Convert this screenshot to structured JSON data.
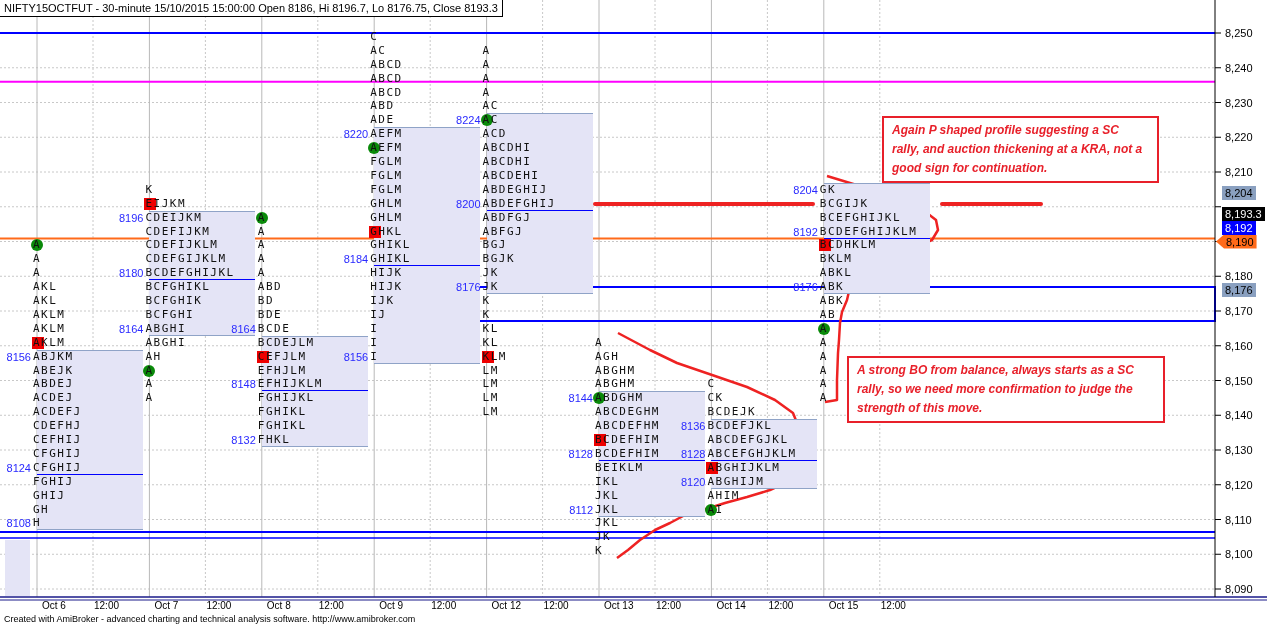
{
  "title": "NIFTY15OCTFUT - 30-minute 15/10/2015 15:00:00 Open 8186, Hi 8196.7, Lo 8176.75, Close 8193.3",
  "days": [
    {
      "date": "Oct 6",
      "time": "12:00",
      "rows": [
        {
          "letters": "A",
          "va": false,
          "poc": false,
          "open": true,
          "close": false
        },
        {
          "letters": "A",
          "va": false,
          "poc": false,
          "open": false,
          "close": false
        },
        {
          "letters": "A",
          "va": false,
          "poc": false,
          "open": false,
          "close": false
        },
        {
          "letters": "AKL",
          "va": false,
          "poc": false,
          "open": false,
          "close": false
        },
        {
          "letters": "AKL",
          "va": false,
          "poc": false,
          "open": false,
          "close": false
        },
        {
          "letters": "AKLM",
          "va": false,
          "poc": false,
          "open": false,
          "close": false
        },
        {
          "letters": "AKLM",
          "va": false,
          "poc": false,
          "open": false,
          "close": false
        },
        {
          "letters": "AKLM",
          "va": false,
          "poc": false,
          "open": false,
          "close": true
        },
        {
          "letters": "ABJKM",
          "label": "8156",
          "va": true,
          "poc": false,
          "open": false,
          "close": false
        },
        {
          "letters": "ABEJK",
          "va": true,
          "poc": false,
          "open": false,
          "close": false
        },
        {
          "letters": "ABDEJ",
          "va": true,
          "poc": false,
          "open": false,
          "close": false
        },
        {
          "letters": "ACDEJ",
          "va": true,
          "poc": false,
          "open": false,
          "close": false
        },
        {
          "letters": "ACDEFJ",
          "va": true,
          "poc": false,
          "open": false,
          "close": false
        },
        {
          "letters": "CDEFHJ",
          "va": true,
          "poc": false,
          "open": false,
          "close": false
        },
        {
          "letters": "CEFHIJ",
          "va": true,
          "poc": false,
          "open": false,
          "close": false
        },
        {
          "letters": "CFGHIJ",
          "va": true,
          "poc": false,
          "open": false,
          "close": false
        },
        {
          "letters": "CFGHIJ",
          "label": "8124",
          "va": true,
          "poc": true,
          "open": false,
          "close": false
        },
        {
          "letters": "FGHIJ",
          "va": true,
          "poc": false,
          "open": false,
          "close": false
        },
        {
          "letters": "GHIJ",
          "va": true,
          "poc": false,
          "open": false,
          "close": false
        },
        {
          "letters": "GH",
          "va": true,
          "poc": false,
          "open": false,
          "close": false
        },
        {
          "letters": "H",
          "label": "8108",
          "va": true,
          "poc": false,
          "open": false,
          "close": false
        }
      ]
    },
    {
      "date": "Oct 7",
      "time": "12:00",
      "rows": [
        {
          "letters": "K",
          "va": false,
          "poc": false,
          "open": false,
          "close": false
        },
        {
          "letters": "EIJKM",
          "va": false,
          "poc": false,
          "open": false,
          "close": true
        },
        {
          "letters": "CDEIJKM",
          "label": "8196",
          "va": true,
          "poc": false,
          "open": false,
          "close": false
        },
        {
          "letters": "CDEFIJKM",
          "va": true,
          "poc": false,
          "open": false,
          "close": false
        },
        {
          "letters": "CDEFIJKLM",
          "va": true,
          "poc": false,
          "open": false,
          "close": false
        },
        {
          "letters": "CDEFGIJKLM",
          "va": true,
          "poc": false,
          "open": false,
          "close": false
        },
        {
          "letters": "BCDEFGHIJKL",
          "label": "8180",
          "va": true,
          "poc": true,
          "open": false,
          "close": false
        },
        {
          "letters": "BCFGHIKL",
          "va": true,
          "poc": false,
          "open": false,
          "close": false
        },
        {
          "letters": "BCFGHIK",
          "va": true,
          "poc": false,
          "open": false,
          "close": false
        },
        {
          "letters": "BCFGHI",
          "va": true,
          "poc": false,
          "open": false,
          "close": false
        },
        {
          "letters": "ABGHI",
          "label": "8164",
          "va": true,
          "poc": false,
          "open": false,
          "close": false
        },
        {
          "letters": "ABGHI",
          "va": false,
          "poc": false,
          "open": false,
          "close": false
        },
        {
          "letters": "AH",
          "va": false,
          "poc": false,
          "open": false,
          "close": false
        },
        {
          "letters": "A",
          "va": false,
          "poc": false,
          "open": true,
          "close": false
        },
        {
          "letters": "A",
          "va": false,
          "poc": false,
          "open": false,
          "close": false
        },
        {
          "letters": "A",
          "va": false,
          "poc": false,
          "open": false,
          "close": false
        }
      ]
    },
    {
      "date": "Oct 8",
      "time": "12:00",
      "rows": [
        {
          "letters": "A",
          "va": false,
          "poc": false,
          "open": true,
          "close": false
        },
        {
          "letters": "A",
          "va": false,
          "poc": false,
          "open": false,
          "close": false
        },
        {
          "letters": "A",
          "va": false,
          "poc": false,
          "open": false,
          "close": false
        },
        {
          "letters": "A",
          "va": false,
          "poc": false,
          "open": false,
          "close": false
        },
        {
          "letters": "A",
          "va": false,
          "poc": false,
          "open": false,
          "close": false
        },
        {
          "letters": "ABD",
          "va": false,
          "poc": false,
          "open": false,
          "close": false
        },
        {
          "letters": "BD",
          "va": false,
          "poc": false,
          "open": false,
          "close": false
        },
        {
          "letters": "BDE",
          "va": false,
          "poc": false,
          "open": false,
          "close": false
        },
        {
          "letters": "BCDE",
          "label": "8164",
          "va": false,
          "poc": false,
          "open": false,
          "close": false
        },
        {
          "letters": "BCDEJLM",
          "va": true,
          "poc": false,
          "open": false,
          "close": false
        },
        {
          "letters": "CEFJLM",
          "va": true,
          "poc": false,
          "open": false,
          "close": true
        },
        {
          "letters": "EFHJLM",
          "va": true,
          "poc": false,
          "open": false,
          "close": false
        },
        {
          "letters": "EFHIJKLM",
          "label": "8148",
          "va": true,
          "poc": true,
          "open": false,
          "close": false
        },
        {
          "letters": "FGHIJKL",
          "va": true,
          "poc": false,
          "open": false,
          "close": false
        },
        {
          "letters": "FGHIKL",
          "va": true,
          "poc": false,
          "open": false,
          "close": false
        },
        {
          "letters": "FGHIKL",
          "va": true,
          "poc": false,
          "open": false,
          "close": false
        },
        {
          "letters": "FHKL",
          "label": "8132",
          "va": true,
          "poc": false,
          "open": false,
          "close": false
        }
      ]
    },
    {
      "date": "Oct 9",
      "time": "12:00",
      "rows": [
        {
          "letters": "C",
          "va": false,
          "poc": false,
          "open": false,
          "close": false
        },
        {
          "letters": "AC",
          "va": false,
          "poc": false,
          "open": false,
          "close": false
        },
        {
          "letters": "ABCD",
          "va": false,
          "poc": false,
          "open": false,
          "close": false
        },
        {
          "letters": "ABCD",
          "va": false,
          "poc": false,
          "open": false,
          "close": false
        },
        {
          "letters": "ABCD",
          "va": false,
          "poc": false,
          "open": false,
          "close": false
        },
        {
          "letters": "ABD",
          "va": false,
          "poc": false,
          "open": false,
          "close": false
        },
        {
          "letters": "ADE",
          "va": false,
          "poc": false,
          "open": false,
          "close": false
        },
        {
          "letters": "AEFM",
          "label": "8220",
          "va": true,
          "poc": false,
          "open": false,
          "close": false
        },
        {
          "letters": "AEFM",
          "va": true,
          "poc": false,
          "open": true,
          "close": false
        },
        {
          "letters": "FGLM",
          "va": true,
          "poc": false,
          "open": false,
          "close": false
        },
        {
          "letters": "FGLM",
          "va": true,
          "poc": false,
          "open": false,
          "close": false
        },
        {
          "letters": "FGLM",
          "va": true,
          "poc": false,
          "open": false,
          "close": false
        },
        {
          "letters": "GHLM",
          "va": true,
          "poc": false,
          "open": false,
          "close": false
        },
        {
          "letters": "GHLM",
          "va": true,
          "poc": false,
          "open": false,
          "close": false
        },
        {
          "letters": "GHKL",
          "va": true,
          "poc": false,
          "open": false,
          "close": true
        },
        {
          "letters": "GHIKL",
          "va": true,
          "poc": false,
          "open": false,
          "close": false
        },
        {
          "letters": "GHIKL",
          "label": "8184",
          "va": true,
          "poc": true,
          "open": false,
          "close": false
        },
        {
          "letters": "HIJK",
          "va": true,
          "poc": false,
          "open": false,
          "close": false
        },
        {
          "letters": "HIJK",
          "va": true,
          "poc": false,
          "open": false,
          "close": false
        },
        {
          "letters": "IJK",
          "va": true,
          "poc": false,
          "open": false,
          "close": false
        },
        {
          "letters": "IJ",
          "va": true,
          "poc": false,
          "open": false,
          "close": false
        },
        {
          "letters": "I",
          "va": true,
          "poc": false,
          "open": false,
          "close": false
        },
        {
          "letters": "I",
          "va": true,
          "poc": false,
          "open": false,
          "close": false
        },
        {
          "letters": "I",
          "label": "8156",
          "va": true,
          "poc": false,
          "open": false,
          "close": false
        }
      ]
    },
    {
      "date": "Oct 12",
      "time": "12:00",
      "rows": [
        {
          "letters": "A",
          "va": false,
          "poc": false,
          "open": false,
          "close": false
        },
        {
          "letters": "A",
          "va": false,
          "poc": false,
          "open": false,
          "close": false
        },
        {
          "letters": "A",
          "va": false,
          "poc": false,
          "open": false,
          "close": false
        },
        {
          "letters": "A",
          "va": false,
          "poc": false,
          "open": false,
          "close": false
        },
        {
          "letters": "AC",
          "va": false,
          "poc": false,
          "open": false,
          "close": false
        },
        {
          "letters": "AC",
          "label": "8224",
          "va": true,
          "poc": false,
          "open": true,
          "close": false
        },
        {
          "letters": "ACD",
          "va": true,
          "poc": false,
          "open": false,
          "close": false
        },
        {
          "letters": "ABCDHI",
          "va": true,
          "poc": false,
          "open": false,
          "close": false
        },
        {
          "letters": "ABCDHI",
          "va": true,
          "poc": false,
          "open": false,
          "close": false
        },
        {
          "letters": "ABCDEHI",
          "va": true,
          "poc": false,
          "open": false,
          "close": false
        },
        {
          "letters": "ABDEGHIJ",
          "va": true,
          "poc": false,
          "open": false,
          "close": false
        },
        {
          "letters": "ABDEFGHIJ",
          "label": "8200",
          "va": true,
          "poc": true,
          "open": false,
          "close": false
        },
        {
          "letters": "ABDFGJ",
          "va": true,
          "poc": false,
          "open": false,
          "close": false
        },
        {
          "letters": "ABFGJ",
          "va": true,
          "poc": false,
          "open": false,
          "close": false
        },
        {
          "letters": "BGJ",
          "va": true,
          "poc": false,
          "open": false,
          "close": false
        },
        {
          "letters": "BGJK",
          "va": true,
          "poc": false,
          "open": false,
          "close": false
        },
        {
          "letters": "JK",
          "va": true,
          "poc": false,
          "open": false,
          "close": false
        },
        {
          "letters": "JK",
          "label": "8176",
          "va": true,
          "poc": false,
          "open": false,
          "close": false
        },
        {
          "letters": "K",
          "va": false,
          "poc": false,
          "open": false,
          "close": false
        },
        {
          "letters": "K",
          "va": false,
          "poc": false,
          "open": false,
          "close": false
        },
        {
          "letters": "KL",
          "va": false,
          "poc": false,
          "open": false,
          "close": false
        },
        {
          "letters": "KL",
          "va": false,
          "poc": false,
          "open": false,
          "close": false
        },
        {
          "letters": "KLM",
          "va": false,
          "poc": false,
          "open": false,
          "close": true
        },
        {
          "letters": "LM",
          "va": false,
          "poc": false,
          "open": false,
          "close": false
        },
        {
          "letters": "LM",
          "va": false,
          "poc": false,
          "open": false,
          "close": false
        },
        {
          "letters": "LM",
          "va": false,
          "poc": false,
          "open": false,
          "close": false
        },
        {
          "letters": "LM",
          "va": false,
          "poc": false,
          "open": false,
          "close": false
        }
      ]
    },
    {
      "date": "Oct 13",
      "time": "12:00",
      "rows": [
        {
          "letters": "A",
          "va": false,
          "poc": false,
          "open": false,
          "close": false
        },
        {
          "letters": "AGH",
          "va": false,
          "poc": false,
          "open": false,
          "close": false
        },
        {
          "letters": "ABGHM",
          "va": false,
          "poc": false,
          "open": false,
          "close": false
        },
        {
          "letters": "ABGHM",
          "va": false,
          "poc": false,
          "open": false,
          "close": false
        },
        {
          "letters": "ABDGHM",
          "label": "8144",
          "va": true,
          "poc": false,
          "open": true,
          "close": false
        },
        {
          "letters": "ABCDEGHM",
          "va": true,
          "poc": false,
          "open": false,
          "close": false
        },
        {
          "letters": "ABCDEFHM",
          "va": true,
          "poc": false,
          "open": false,
          "close": false
        },
        {
          "letters": "BCDEFHIM",
          "va": true,
          "poc": false,
          "open": false,
          "close": true
        },
        {
          "letters": "BCDEFHIM",
          "label": "8128",
          "va": true,
          "poc": true,
          "open": false,
          "close": false
        },
        {
          "letters": "BEIKLM",
          "va": true,
          "poc": false,
          "open": false,
          "close": false
        },
        {
          "letters": "IKL",
          "va": true,
          "poc": false,
          "open": false,
          "close": false
        },
        {
          "letters": "JKL",
          "va": true,
          "poc": false,
          "open": false,
          "close": false
        },
        {
          "letters": "JKL",
          "label": "8112",
          "va": true,
          "poc": false,
          "open": false,
          "close": false
        },
        {
          "letters": "JKL",
          "va": false,
          "poc": false,
          "open": false,
          "close": false
        },
        {
          "letters": "JK",
          "va": false,
          "poc": false,
          "open": false,
          "close": false
        },
        {
          "letters": "K",
          "va": false,
          "poc": false,
          "open": false,
          "close": false
        }
      ]
    },
    {
      "date": "Oct 14",
      "time": "12:00",
      "rows": [
        {
          "letters": "C",
          "va": false,
          "poc": false,
          "open": false,
          "close": false
        },
        {
          "letters": "CK",
          "va": false,
          "poc": false,
          "open": false,
          "close": false
        },
        {
          "letters": "BCDEJK",
          "va": false,
          "poc": false,
          "open": false,
          "close": false
        },
        {
          "letters": "BCDEFJKL",
          "label": "8136",
          "va": true,
          "poc": false,
          "open": false,
          "close": false
        },
        {
          "letters": "ABCDEFGJKL",
          "va": true,
          "poc": false,
          "open": false,
          "close": false
        },
        {
          "letters": "ABCEFGHJKLM",
          "label": "8128",
          "va": true,
          "poc": true,
          "open": false,
          "close": false
        },
        {
          "letters": "ABGHIJKLM",
          "va": true,
          "poc": false,
          "open": false,
          "close": true
        },
        {
          "letters": "ABGHIJM",
          "label": "8120",
          "va": true,
          "poc": false,
          "open": false,
          "close": false
        },
        {
          "letters": "AHIM",
          "va": false,
          "poc": false,
          "open": false,
          "close": false
        },
        {
          "letters": "AI",
          "va": false,
          "poc": false,
          "open": true,
          "close": false
        }
      ]
    },
    {
      "date": "Oct 15",
      "time": "12:00",
      "rows": [
        {
          "letters": "GK",
          "label": "8204",
          "va": true,
          "poc": false,
          "open": false,
          "close": false
        },
        {
          "letters": "BCGIJK",
          "va": true,
          "poc": false,
          "open": false,
          "close": false
        },
        {
          "letters": "BCEFGHIJKL",
          "va": true,
          "poc": false,
          "open": false,
          "close": false
        },
        {
          "letters": "BCDEFGHIJKLM",
          "label": "8192",
          "va": true,
          "poc": true,
          "open": false,
          "close": false
        },
        {
          "letters": "BCDHKLM",
          "va": true,
          "poc": false,
          "open": false,
          "close": true
        },
        {
          "letters": "BKLM",
          "va": true,
          "poc": false,
          "open": false,
          "close": false
        },
        {
          "letters": "ABKL",
          "va": true,
          "poc": false,
          "open": false,
          "close": false
        },
        {
          "letters": "ABK",
          "label": "8176",
          "va": true,
          "poc": false,
          "open": false,
          "close": false
        },
        {
          "letters": "ABK",
          "va": false,
          "poc": false,
          "open": false,
          "close": false
        },
        {
          "letters": "AB",
          "va": false,
          "poc": false,
          "open": false,
          "close": false
        },
        {
          "letters": "A",
          "va": false,
          "poc": false,
          "open": true,
          "close": false
        },
        {
          "letters": "A",
          "va": false,
          "poc": false,
          "open": false,
          "close": false
        },
        {
          "letters": "A",
          "va": false,
          "poc": false,
          "open": false,
          "close": false
        },
        {
          "letters": "A",
          "va": false,
          "poc": false,
          "open": false,
          "close": false
        },
        {
          "letters": "A",
          "va": false,
          "poc": false,
          "open": false,
          "close": false
        },
        {
          "letters": "A",
          "va": false,
          "poc": false,
          "open": false,
          "close": false
        }
      ]
    }
  ],
  "notes": [
    {
      "text": "Again P shaped profile suggesting a SC rally, and auction thickening at a KRA, not a good sign for continuation."
    },
    {
      "text": "A strong BO from balance, always starts as a SC rally, so we need more confirmation to judge the strength of this move."
    }
  ],
  "price_axis": {
    "ticks": [
      "8,250",
      "8,240",
      "8,230",
      "8,220",
      "8,210",
      "8,180",
      "8,170",
      "8,160",
      "8,150",
      "8,140",
      "8,130",
      "8,120",
      "8,110",
      "8,100",
      "8,090"
    ],
    "badges": [
      {
        "text": "8,204",
        "kind": "level"
      },
      {
        "text": "8,193.3",
        "kind": "last"
      },
      {
        "text": "8,192",
        "kind": "poc"
      },
      {
        "text": "8,190",
        "kind": "arrow"
      },
      {
        "text": "8,176",
        "kind": "level"
      }
    ]
  },
  "footer": "Created with AmiBroker - advanced charting and technical analysis software. http://www.amibroker.com"
}
